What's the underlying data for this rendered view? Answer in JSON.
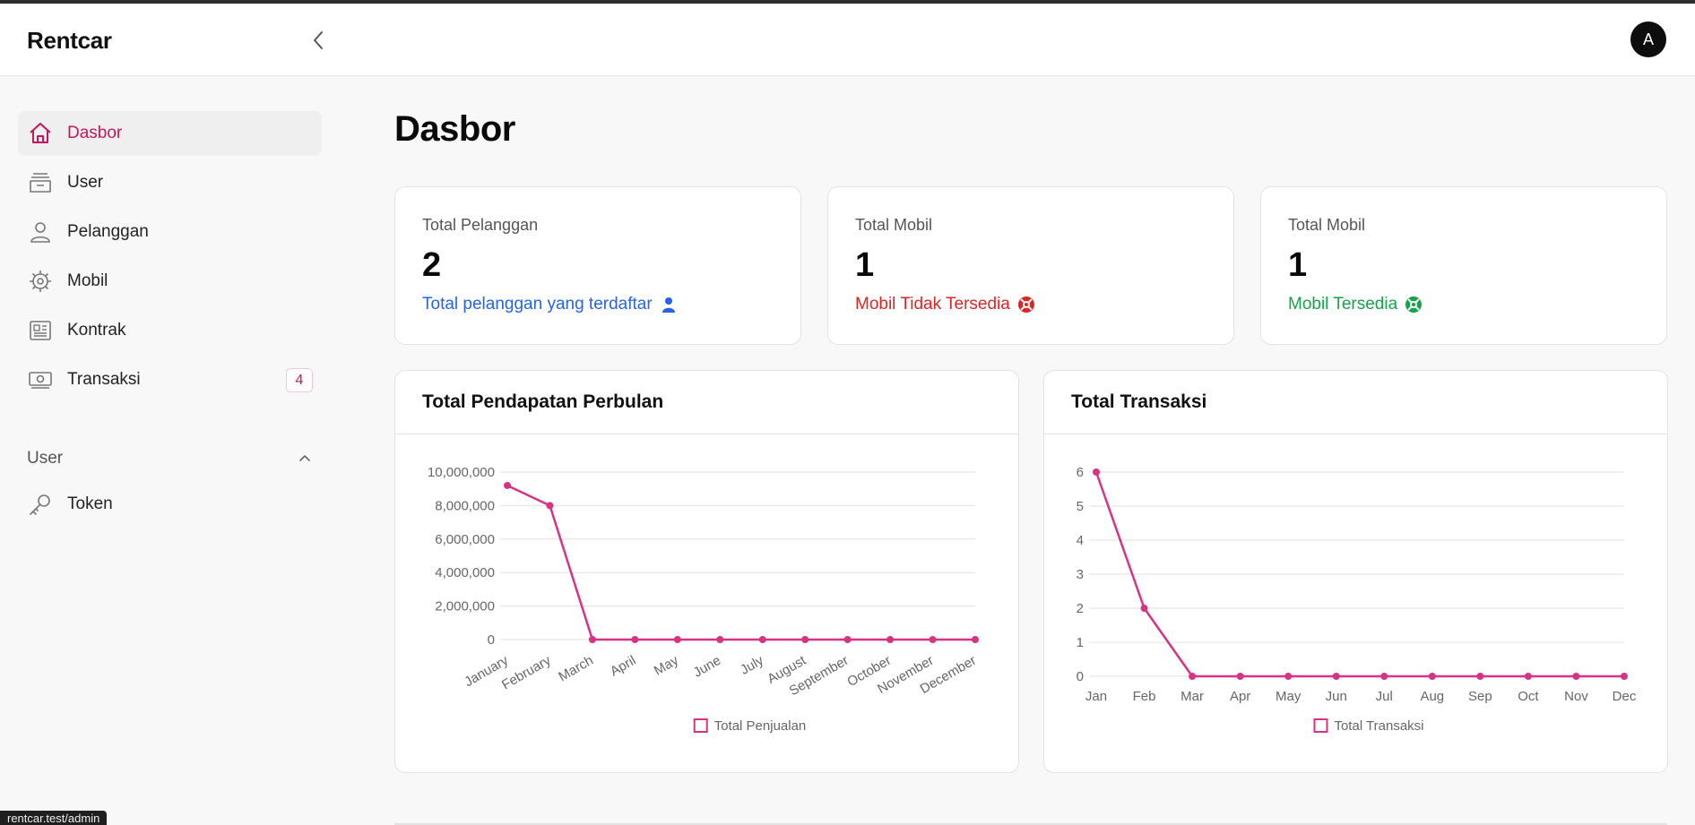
{
  "header": {
    "brand": "Rentcar",
    "avatar_initial": "A"
  },
  "sidebar": {
    "items": [
      {
        "label": "Dasbor",
        "icon": "home-icon",
        "active": true
      },
      {
        "label": "User",
        "icon": "archive-icon"
      },
      {
        "label": "Pelanggan",
        "icon": "person-icon"
      },
      {
        "label": "Mobil",
        "icon": "gear-icon"
      },
      {
        "label": "Kontrak",
        "icon": "newspaper-icon"
      },
      {
        "label": "Transaksi",
        "icon": "cash-icon",
        "badge": "4"
      }
    ],
    "section": {
      "label": "User",
      "items": [
        {
          "label": "Token",
          "icon": "key-icon"
        }
      ]
    }
  },
  "page": {
    "title": "Dasbor"
  },
  "stats": [
    {
      "label": "Total Pelanggan",
      "value": "2",
      "note": "Total pelanggan yang terdaftar",
      "note_color": "#2563eb",
      "icon": "person-icon"
    },
    {
      "label": "Total Mobil",
      "value": "1",
      "note": "Mobil Tidak Tersedia",
      "note_color": "#dc2626",
      "icon": "lifebuoy-icon"
    },
    {
      "label": "Total Mobil",
      "value": "1",
      "note": "Mobil Tersedia",
      "note_color": "#16a34a",
      "icon": "lifebuoy-icon"
    }
  ],
  "colors": {
    "accent": "#d63384",
    "active_text": "#c2185b"
  },
  "chart_data": [
    {
      "type": "line",
      "title": "Total Pendapatan Perbulan",
      "categories": [
        "January",
        "February",
        "March",
        "April",
        "May",
        "June",
        "July",
        "August",
        "September",
        "October",
        "November",
        "December"
      ],
      "series": [
        {
          "name": "Total Penjualan",
          "values": [
            9200000,
            8000000,
            0,
            0,
            0,
            0,
            0,
            0,
            0,
            0,
            0,
            0
          ]
        }
      ],
      "ylim": [
        0,
        10000000
      ],
      "yticks": [
        "0",
        "2,000,000",
        "4,000,000",
        "6,000,000",
        "8,000,000",
        "10,000,000"
      ],
      "legend": "bottom"
    },
    {
      "type": "line",
      "title": "Total Transaksi",
      "categories": [
        "Jan",
        "Feb",
        "Mar",
        "Apr",
        "May",
        "Jun",
        "Jul",
        "Aug",
        "Sep",
        "Oct",
        "Nov",
        "Dec"
      ],
      "series": [
        {
          "name": "Total Transaksi",
          "values": [
            6,
            2,
            0,
            0,
            0,
            0,
            0,
            0,
            0,
            0,
            0,
            0
          ]
        }
      ],
      "ylim": [
        0,
        6
      ],
      "yticks": [
        "0",
        "1",
        "2",
        "3",
        "4",
        "5",
        "6"
      ],
      "legend": "bottom"
    }
  ],
  "status_url": "rentcar.test/admin"
}
